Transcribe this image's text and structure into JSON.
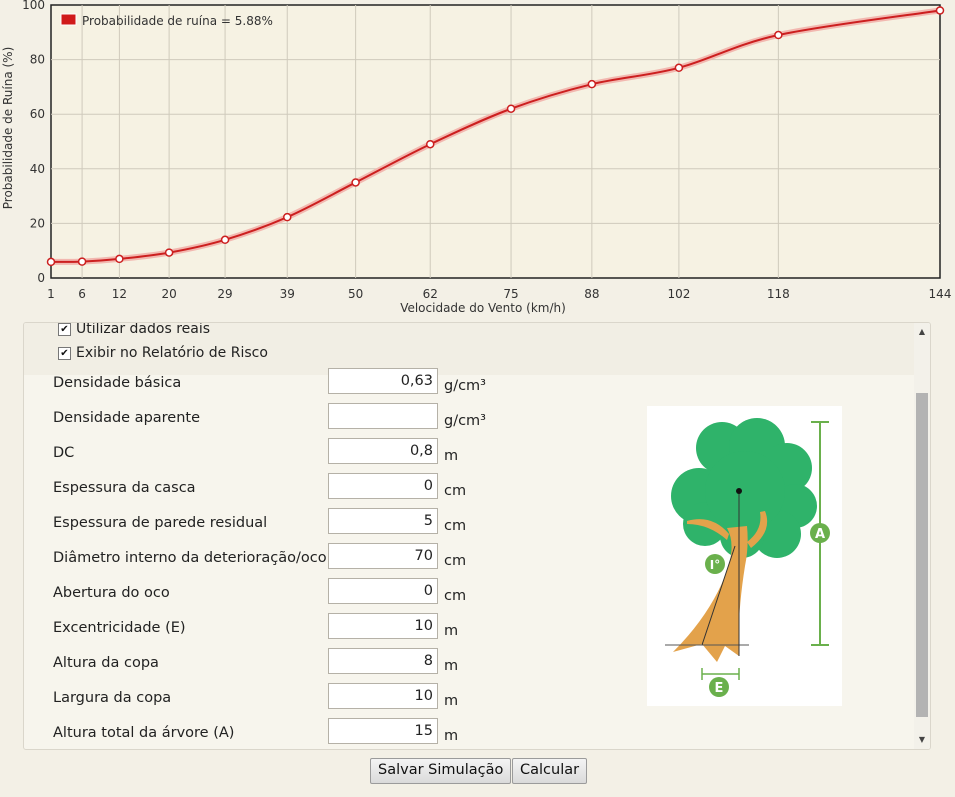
{
  "chart_data": {
    "type": "line",
    "xlabel": "Velocidade do Vento (km/h)",
    "ylabel": "Probabilidade de Ruína (%)",
    "legend": "Probabilidade de ruína = 5.88%",
    "legend_position": "top-left",
    "x_ticks": [
      "1",
      "6",
      "12",
      "20",
      "29",
      "39",
      "50",
      "62",
      "75",
      "88",
      "102",
      "118",
      "144"
    ],
    "y_ticks": [
      "0",
      "20",
      "40",
      "60",
      "80",
      "100"
    ],
    "ylim": [
      0,
      100
    ],
    "grid": true,
    "series": [
      {
        "name": "Probabilidade de ruína = 5.88%",
        "color": "#cc1f1f",
        "values": [
          5.9,
          6.0,
          7.0,
          9.3,
          14.0,
          22.3,
          35.0,
          49.0,
          62.0,
          71.0,
          77.0,
          89.0,
          98.0
        ]
      }
    ]
  },
  "form": {
    "checkbox_real_data": "Utilizar dados reais",
    "checkbox_risk_report": "Exibir no Relatório de Risco",
    "fields": [
      {
        "label": "Densidade básica",
        "value": "0,63",
        "unit": "g/cm³"
      },
      {
        "label": "Densidade aparente",
        "value": "",
        "unit": "g/cm³"
      },
      {
        "label": "DC",
        "value": "0,8",
        "unit": "m"
      },
      {
        "label": "Espessura da casca",
        "value": "0",
        "unit": "cm"
      },
      {
        "label": "Espessura de parede residual",
        "value": "5",
        "unit": "cm"
      },
      {
        "label": "Diâmetro interno da deterioração/oco",
        "value": "70",
        "unit": "cm"
      },
      {
        "label": "Abertura do oco",
        "value": "0",
        "unit": "cm"
      },
      {
        "label": "Excentricidade (E)",
        "value": "10",
        "unit": "m"
      },
      {
        "label": "Altura da copa",
        "value": "8",
        "unit": "m"
      },
      {
        "label": "Largura da copa",
        "value": "10",
        "unit": "m"
      },
      {
        "label": "Altura total da árvore (A)",
        "value": "15",
        "unit": "m"
      }
    ]
  },
  "diagram": {
    "label_a": "A",
    "label_i": "I°",
    "label_e": "E"
  },
  "buttons": {
    "save": "Salvar Simulação",
    "calculate": "Calcular"
  },
  "colors": {
    "line": "#cc1f1f",
    "plot_bg": "#f6f2e3",
    "tree_green": "#2fb36a",
    "trunk": "#e3a24b",
    "measure": "#6ab04c"
  }
}
